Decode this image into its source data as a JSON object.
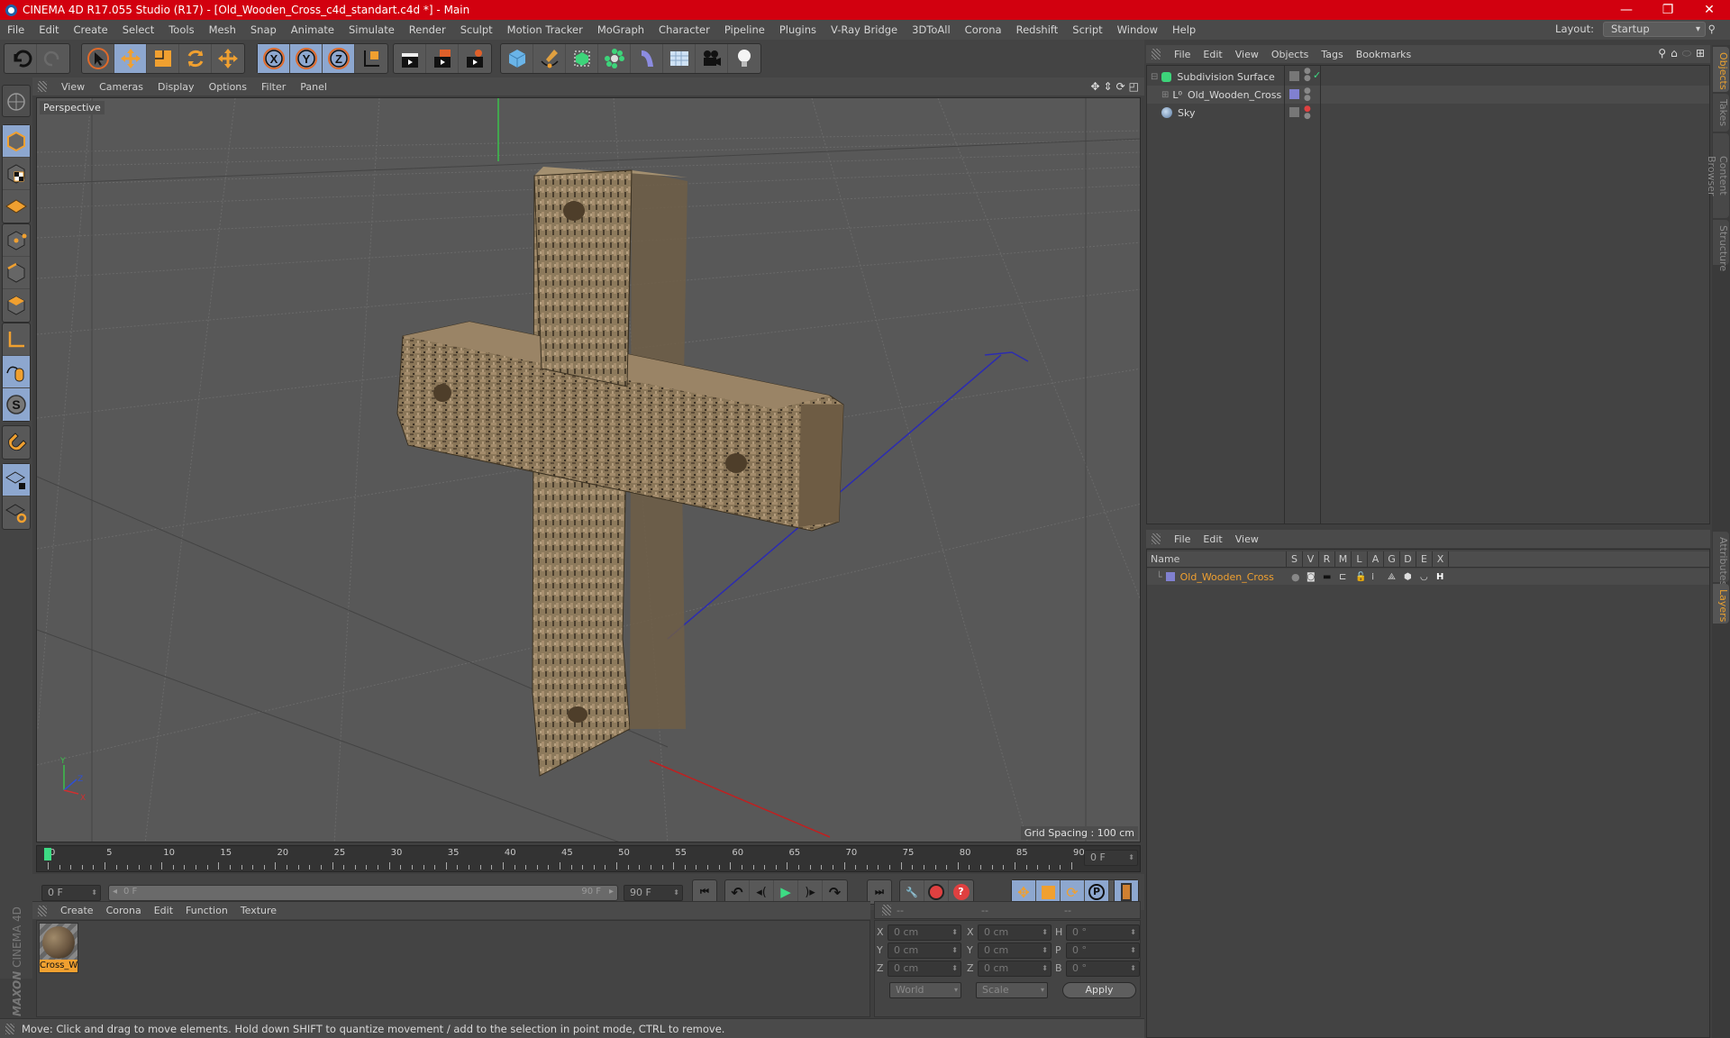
{
  "titlebar": {
    "title": "CINEMA 4D R17.055 Studio (R17) - [Old_Wooden_Cross_c4d_standart.c4d *] - Main",
    "minimize": "—",
    "restore": "❐",
    "close": "✕"
  },
  "menubar": {
    "items": [
      "File",
      "Edit",
      "Create",
      "Select",
      "Tools",
      "Mesh",
      "Snap",
      "Animate",
      "Simulate",
      "Render",
      "Sculpt",
      "Motion Tracker",
      "MoGraph",
      "Character",
      "Pipeline",
      "Plugins",
      "V-Ray Bridge",
      "3DToAll",
      "Corona",
      "Redshift",
      "Script",
      "Window",
      "Help"
    ],
    "layout_label": "Layout:",
    "layout_value": "Startup"
  },
  "toolbar": {
    "groups": [
      [
        "undo",
        "redo"
      ],
      [
        "live-selection",
        "move",
        "scale",
        "rotate",
        "recent-tool-move"
      ],
      [
        "x-axis-lock",
        "y-axis-lock",
        "z-axis-lock",
        "coordinate-system"
      ],
      [
        "render-view",
        "render-to-picture-viewer",
        "render-settings"
      ],
      [
        "cube",
        "pen-spline",
        "subdivision-surface",
        "cloner",
        "deformer",
        "floor",
        "camera",
        "light"
      ]
    ]
  },
  "viewport": {
    "menu": [
      "View",
      "Cameras",
      "Display",
      "Options",
      "Filter",
      "Panel"
    ],
    "label": "Perspective",
    "grid_spacing": "Grid Spacing : 100 cm",
    "axis_labels": {
      "x": "X",
      "y": "Y",
      "z": "Z"
    }
  },
  "left_tools": [
    "make-editable",
    "model-mode",
    "texture-mode",
    "workplane-mode",
    "points-mode",
    "edges-mode",
    "polygons-mode",
    "axis-mode",
    "tweak-mode",
    "solo-mode",
    "snapping",
    "lock-workplane",
    "workplane-align"
  ],
  "timeline": {
    "ticks": [
      "0",
      "5",
      "10",
      "15",
      "20",
      "25",
      "30",
      "35",
      "40",
      "45",
      "50",
      "55",
      "60",
      "65",
      "70",
      "75",
      "80",
      "85",
      "90"
    ],
    "current_frame": "0 F",
    "start_field": "0 F",
    "range_start": "0 F",
    "range_end": "90 F",
    "end_field": "90 F",
    "current_position": 0,
    "max_frame": 90
  },
  "material_manager": {
    "menu": [
      "Create",
      "Corona",
      "Edit",
      "Function",
      "Texture"
    ],
    "materials": [
      {
        "name": "Cross_W"
      }
    ]
  },
  "coordinates": {
    "headers": [
      "--",
      "--",
      "--"
    ],
    "rows": [
      {
        "l1": "X",
        "v1": "0 cm",
        "l2": "X",
        "v2": "0 cm",
        "l3": "H",
        "v3": "0 °"
      },
      {
        "l1": "Y",
        "v1": "0 cm",
        "l2": "Y",
        "v2": "0 cm",
        "l3": "P",
        "v3": "0 °"
      },
      {
        "l1": "Z",
        "v1": "0 cm",
        "l2": "Z",
        "v2": "0 cm",
        "l3": "B",
        "v3": "0 °"
      }
    ],
    "mode": "World",
    "transform": "Scale",
    "apply": "Apply"
  },
  "status": "Move: Click and drag to move elements. Hold down SHIFT to quantize movement / add to the selection in point mode, CTRL to remove.",
  "brand": {
    "maxon": "MAXON",
    "product": "CINEMA 4D"
  },
  "object_manager": {
    "menu": [
      "File",
      "Edit",
      "View",
      "Objects",
      "Tags",
      "Bookmarks"
    ],
    "objects": [
      {
        "name": "Subdivision Surface",
        "icon": "subdivision-surface-icon"
      },
      {
        "name": "Old_Wooden_Cross",
        "icon": "null-object-icon"
      },
      {
        "name": "Sky",
        "icon": "sky-icon"
      }
    ]
  },
  "layer_manager": {
    "menu": [
      "File",
      "Edit",
      "View"
    ],
    "columns": [
      "Name",
      "S",
      "V",
      "R",
      "M",
      "L",
      "A",
      "G",
      "D",
      "E",
      "X"
    ],
    "layers": [
      {
        "name": "Old_Wooden_Cross",
        "color": "#8080d0"
      }
    ]
  },
  "right_tabs": {
    "top": [
      "Objects",
      "Takes",
      "Content Browser",
      "Structure"
    ],
    "bottom": [
      "Attributes",
      "Layers"
    ]
  },
  "colors": {
    "titlebar": "#d2000f",
    "accent_orange": "#f0a030",
    "active_blue": "#8da7cf",
    "layer_color": "#8080d0",
    "play_green": "#3ddc84"
  }
}
